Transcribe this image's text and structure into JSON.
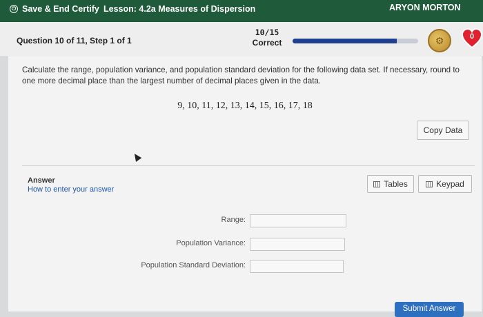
{
  "topbar": {
    "save_label": "Save & End Certify",
    "lesson": "Lesson: 4.2a Measures of Dispersion",
    "user": "ARYON MORTON"
  },
  "question_bar": {
    "question_label": "Question 10 of 11, Step 1 of 1",
    "score_fraction": "10/15",
    "score_label": "Correct",
    "progress": 0.83,
    "hearts_count": "0",
    "accent_color": "#1f3f8f",
    "heart_color": "#e0222f"
  },
  "problem": {
    "prompt": "Calculate the range, population variance, and population standard deviation for the following data set. If necessary, round to one more decimal place than the largest number of decimal places given in the data.",
    "dataset": "9, 10, 11, 12, 13, 14, 15, 16, 17, 18",
    "copy_data_label": "Copy Data"
  },
  "answer": {
    "label": "Answer",
    "help_link": "How to enter your answer",
    "tables_label": "Tables",
    "keypad_label": "Keypad",
    "fields": [
      {
        "label": "Range:",
        "value": ""
      },
      {
        "label": "Population Variance:",
        "value": ""
      },
      {
        "label": "Population Standard Deviation:",
        "value": ""
      }
    ],
    "submit_label": "Submit Answer"
  }
}
